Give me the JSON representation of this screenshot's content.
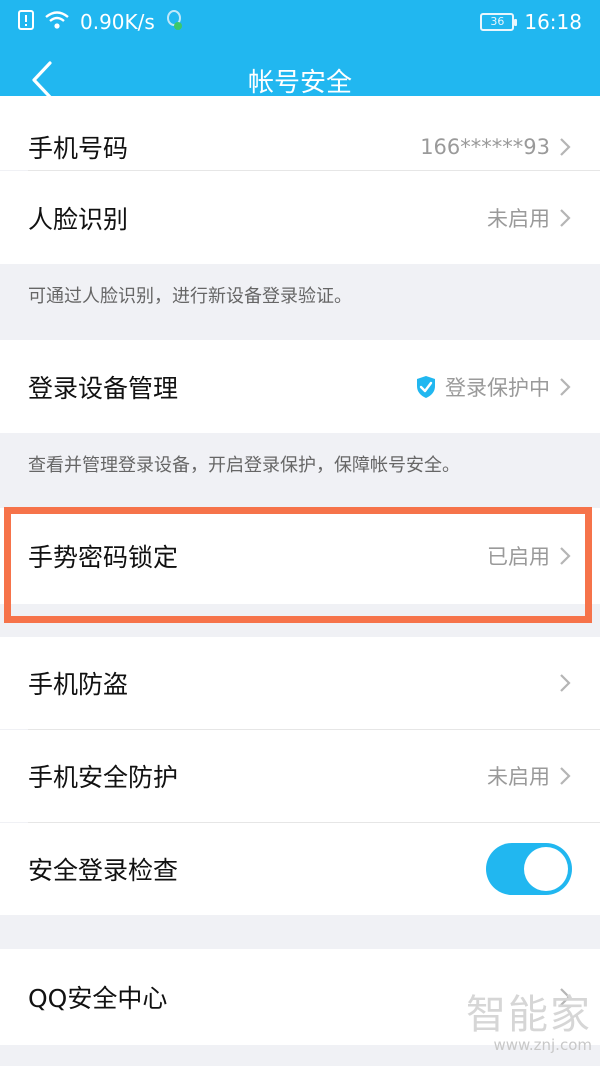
{
  "status": {
    "net_speed": "0.90K/s",
    "battery": "36",
    "time": "16:18"
  },
  "header": {
    "title": "帐号安全"
  },
  "rows": {
    "phone": {
      "label": "手机号码",
      "value": "166******93"
    },
    "face": {
      "label": "人脸识别",
      "value": "未启用"
    },
    "face_note": "可通过人脸识别，进行新设备登录验证。",
    "device": {
      "label": "登录设备管理",
      "value": "登录保护中"
    },
    "device_note": "查看并管理登录设备，开启登录保护，保障帐号安全。",
    "gesture": {
      "label": "手势密码锁定",
      "value": "已启用"
    },
    "antitheft": {
      "label": "手机防盗"
    },
    "phone_protect": {
      "label": "手机安全防护",
      "value": "未启用"
    },
    "safe_login": {
      "label": "安全登录检查",
      "toggle_on": true
    },
    "qq_center": {
      "label": "QQ安全中心"
    }
  },
  "watermark": {
    "brand": "智能家",
    "url": "www.znj.com"
  },
  "colors": {
    "accent": "#21b7f0",
    "highlight": "#f6734a",
    "shield": "#21b7f0"
  }
}
